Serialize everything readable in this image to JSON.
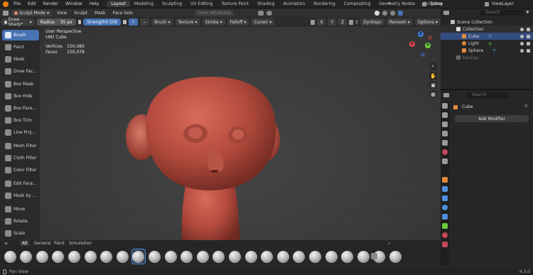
{
  "topbar": {
    "menus": [
      "File",
      "Edit",
      "Render",
      "Window",
      "Help"
    ],
    "workspaces": [
      "Layout",
      "Modeling",
      "Sculpting",
      "UV Editing",
      "Texture Paint",
      "Shading",
      "Animation",
      "Rendering",
      "Compositing",
      "Geometry Nodes",
      "Scripting"
    ],
    "active_workspace": "Layout",
    "scene": "Scene",
    "view_layer": "ViewLayer"
  },
  "header": {
    "mode": "Sculpt Mode",
    "menus": [
      "View",
      "Sculpt",
      "Mask",
      "Face Sets"
    ],
    "color_attributes": "Color Attributes"
  },
  "tool_settings": {
    "brush": "Draw Sharp*",
    "radius_label": "Radius",
    "radius_value": "35 px",
    "strength_label": "Strength",
    "strength_value": "0.500",
    "dropdowns": [
      "Brush",
      "Texture",
      "Stroke",
      "Falloff",
      "Cursor"
    ],
    "axes": [
      "X",
      "Y",
      "Z"
    ],
    "dyntopo": "Dyntopo",
    "remesh": "Remesh",
    "options": "Options"
  },
  "toolbar": {
    "tools": [
      "Brush",
      "Paint",
      "Mask",
      "Draw Fac...",
      "Box Mask",
      "Box Hide",
      "Box Face...",
      "Box Trim",
      "Line Proj...",
      "Mesh Filter",
      "Cloth Filter",
      "Color Filter",
      "Edit Face...",
      "Mask by ...",
      "Move",
      "Rotate",
      "Scale"
    ],
    "active": "Brush"
  },
  "viewport": {
    "view_name": "User Perspective",
    "object": "(48) Cube",
    "vertices_label": "Vertices",
    "vertices_value": "150,080",
    "faces_label": "Faces",
    "faces_value": "150,078",
    "gizmo": [
      "X",
      "Y",
      "Z"
    ]
  },
  "brushbar": {
    "tabs": [
      "All",
      "General",
      "Paint",
      "Simulation"
    ],
    "active_tab": "All",
    "brush_count": 25,
    "selected_index": 8
  },
  "outliner": {
    "search_placeholder": "Search",
    "root": "Scene Collection",
    "collection": "Collection",
    "items": [
      "Cube",
      "Light",
      "Sphere"
    ],
    "extra": "backup"
  },
  "properties": {
    "search_placeholder": "Search",
    "object": "Cube",
    "add_modifier": "Add Modifier"
  },
  "status": {
    "left": "Pan View",
    "version": "4.3.0"
  },
  "colors": {
    "accent": "#4772b3",
    "head": "#b24a3d"
  }
}
